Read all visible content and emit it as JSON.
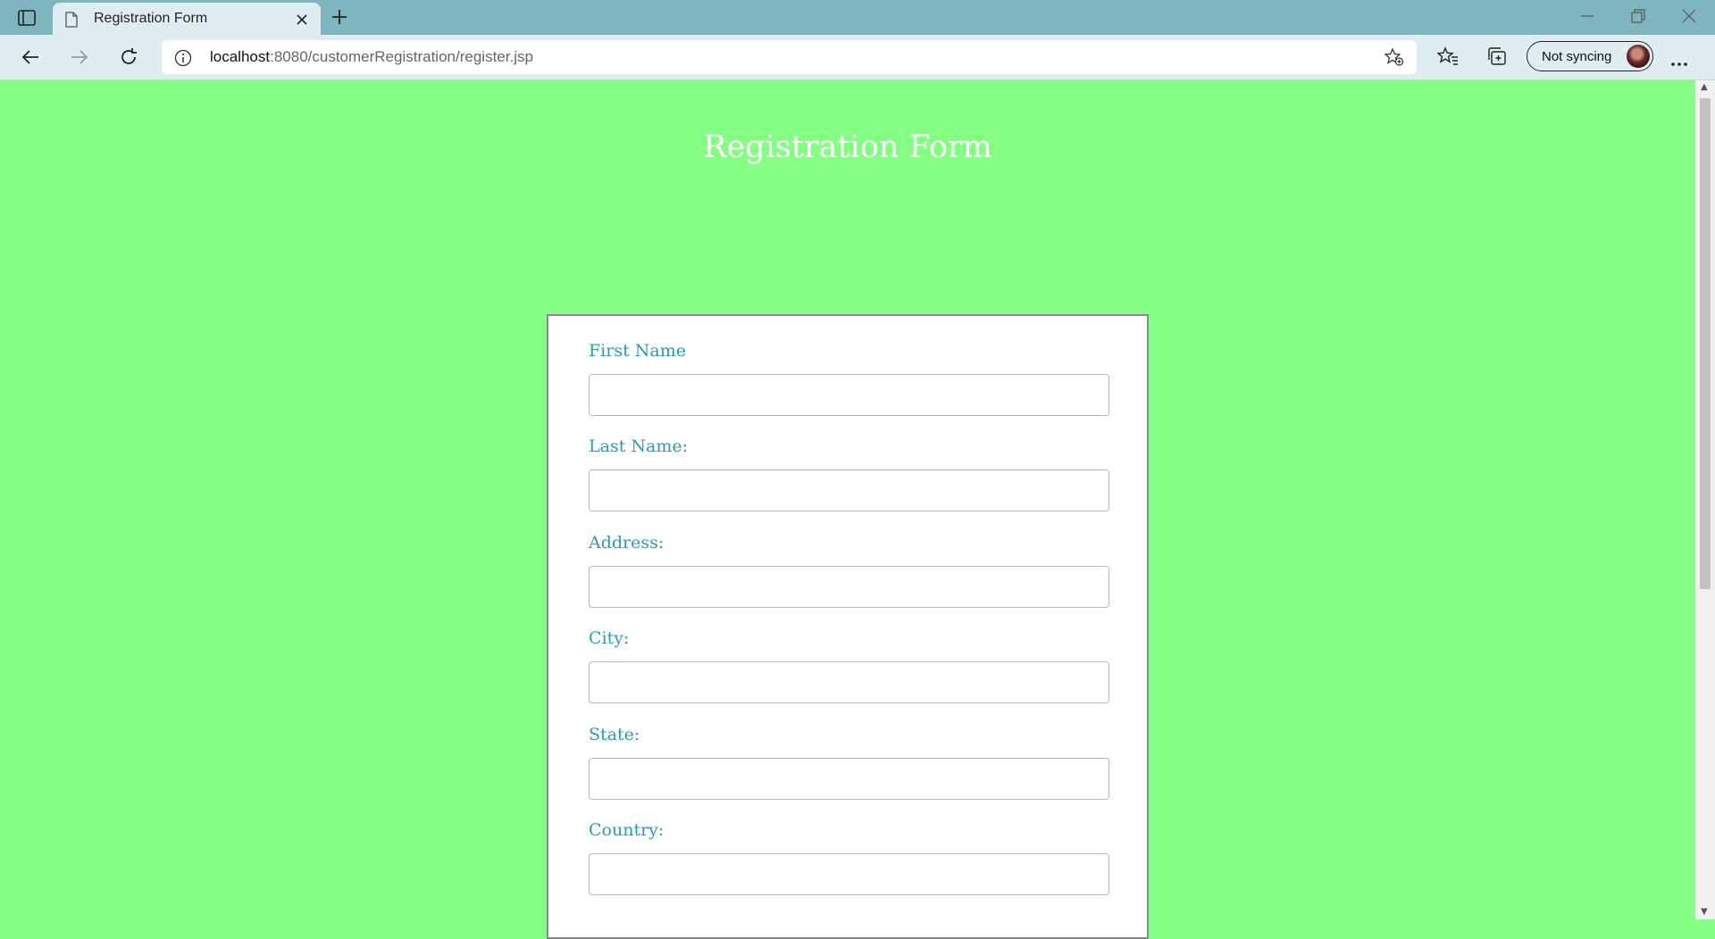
{
  "browser": {
    "tab_title": "Registration Form",
    "url_host": "localhost",
    "url_rest": ":8080/customerRegistration/register.jsp",
    "sync_label": "Not syncing"
  },
  "page": {
    "title": "Registration Form",
    "background": "#84ff84"
  },
  "form": {
    "fields": [
      {
        "label": "First Name",
        "value": ""
      },
      {
        "label": "Last Name:",
        "value": ""
      },
      {
        "label": "Address:",
        "value": ""
      },
      {
        "label": "City:",
        "value": ""
      },
      {
        "label": "State:",
        "value": ""
      },
      {
        "label": "Country:",
        "value": ""
      }
    ]
  }
}
